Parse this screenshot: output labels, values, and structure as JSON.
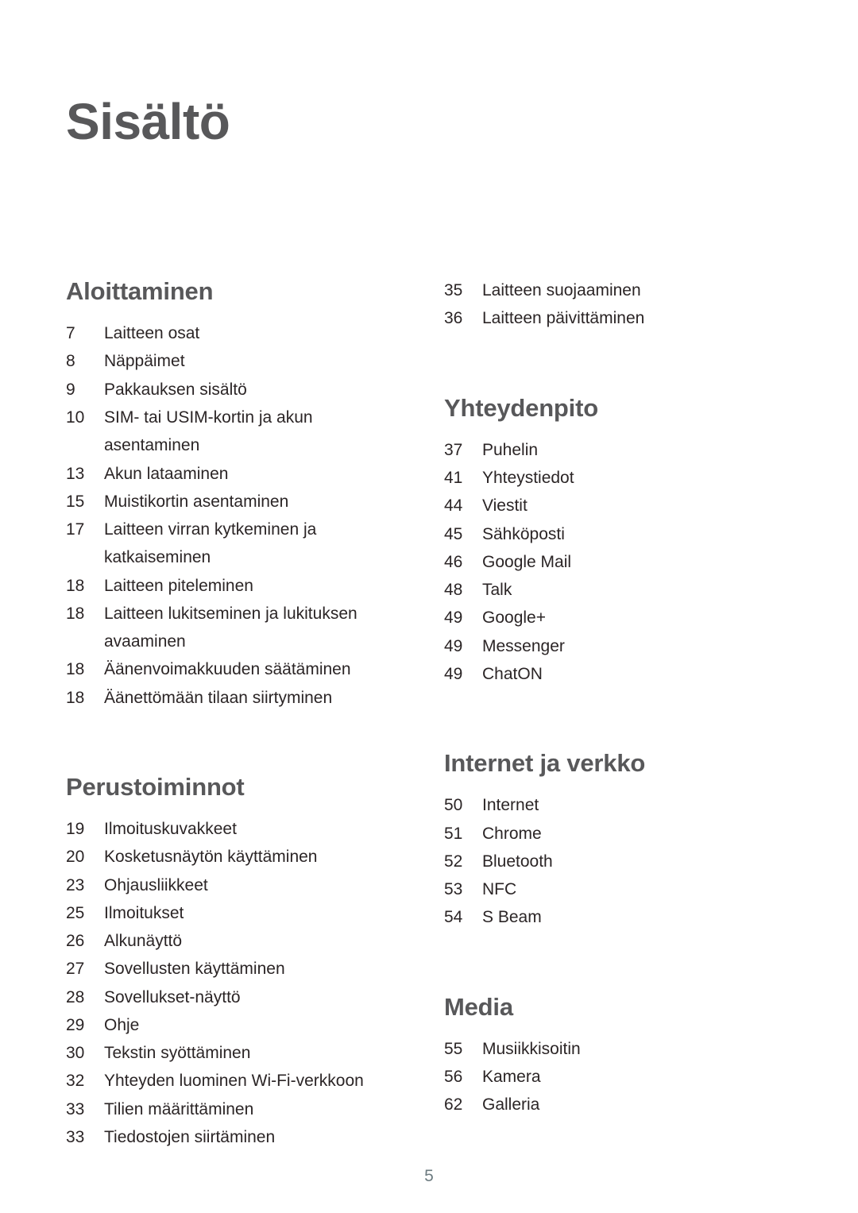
{
  "document": {
    "title": "Sisältö",
    "page_number": "5",
    "colors": {
      "heading": "#58585a",
      "body": "#2b2526",
      "page_number": "#6d7b80",
      "background": "#ffffff"
    }
  },
  "columns": {
    "left": [
      {
        "heading": "Aloittaminen",
        "entries": [
          {
            "page": "7",
            "title": "Laitteen osat"
          },
          {
            "page": "8",
            "title": "Näppäimet"
          },
          {
            "page": "9",
            "title": "Pakkauksen sisältö"
          },
          {
            "page": "10",
            "title": "SIM- tai USIM-kortin ja akun asentaminen"
          },
          {
            "page": "13",
            "title": "Akun lataaminen"
          },
          {
            "page": "15",
            "title": "Muistikortin asentaminen"
          },
          {
            "page": "17",
            "title": "Laitteen virran kytkeminen ja katkaiseminen"
          },
          {
            "page": "18",
            "title": "Laitteen piteleminen"
          },
          {
            "page": "18",
            "title": "Laitteen lukitseminen ja lukituksen avaaminen"
          },
          {
            "page": "18",
            "title": "Äänenvoimakkuuden säätäminen"
          },
          {
            "page": "18",
            "title": "Äänettömään tilaan siirtyminen"
          }
        ]
      },
      {
        "heading": "Perustoiminnot",
        "entries": [
          {
            "page": "19",
            "title": "Ilmoituskuvakkeet"
          },
          {
            "page": "20",
            "title": "Kosketusnäytön käyttäminen"
          },
          {
            "page": "23",
            "title": "Ohjausliikkeet"
          },
          {
            "page": "25",
            "title": "Ilmoitukset"
          },
          {
            "page": "26",
            "title": "Alkunäyttö"
          },
          {
            "page": "27",
            "title": "Sovellusten käyttäminen"
          },
          {
            "page": "28",
            "title": "Sovellukset-näyttö"
          },
          {
            "page": "29",
            "title": "Ohje"
          },
          {
            "page": "30",
            "title": "Tekstin syöttäminen"
          },
          {
            "page": "32",
            "title": "Yhteyden luominen Wi-Fi-verkkoon"
          },
          {
            "page": "33",
            "title": "Tilien määrittäminen"
          },
          {
            "page": "33",
            "title": "Tiedostojen siirtäminen"
          }
        ]
      }
    ],
    "right": [
      {
        "heading": "",
        "entries": [
          {
            "page": "35",
            "title": "Laitteen suojaaminen"
          },
          {
            "page": "36",
            "title": "Laitteen päivittäminen"
          }
        ]
      },
      {
        "heading": "Yhteydenpito",
        "entries": [
          {
            "page": "37",
            "title": "Puhelin"
          },
          {
            "page": "41",
            "title": "Yhteystiedot"
          },
          {
            "page": "44",
            "title": "Viestit"
          },
          {
            "page": "45",
            "title": "Sähköposti"
          },
          {
            "page": "46",
            "title": "Google Mail"
          },
          {
            "page": "48",
            "title": "Talk"
          },
          {
            "page": "49",
            "title": "Google+"
          },
          {
            "page": "49",
            "title": "Messenger"
          },
          {
            "page": "49",
            "title": "ChatON"
          }
        ]
      },
      {
        "heading": "Internet ja verkko",
        "entries": [
          {
            "page": "50",
            "title": "Internet"
          },
          {
            "page": "51",
            "title": "Chrome"
          },
          {
            "page": "52",
            "title": "Bluetooth"
          },
          {
            "page": "53",
            "title": "NFC"
          },
          {
            "page": "54",
            "title": "S Beam"
          }
        ]
      },
      {
        "heading": "Media",
        "entries": [
          {
            "page": "55",
            "title": "Musiikkisoitin"
          },
          {
            "page": "56",
            "title": "Kamera"
          },
          {
            "page": "62",
            "title": "Galleria"
          }
        ]
      }
    ]
  }
}
